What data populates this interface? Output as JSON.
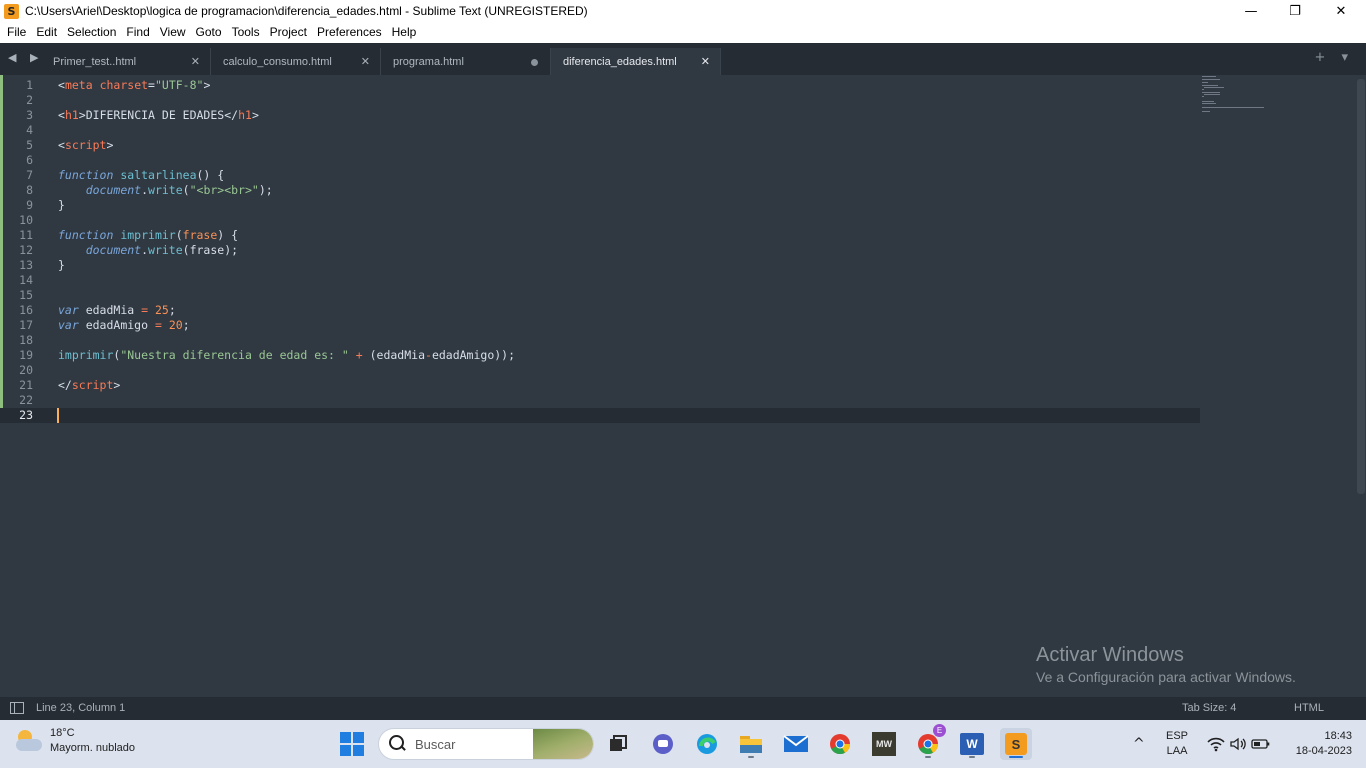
{
  "window": {
    "title": "C:\\Users\\Ariel\\Desktop\\logica de programacion\\diferencia_edades.html - Sublime Text (UNREGISTERED)",
    "app_logo_letter": "S",
    "controls": {
      "minimize": "—",
      "restore": "❐",
      "close": "✕"
    }
  },
  "menu": [
    "File",
    "Edit",
    "Selection",
    "Find",
    "View",
    "Goto",
    "Tools",
    "Project",
    "Preferences",
    "Help"
  ],
  "tabs": [
    {
      "label": "Primer_test..html",
      "state": "close"
    },
    {
      "label": "calculo_consumo.html",
      "state": "close"
    },
    {
      "label": "programa.html",
      "state": "modified"
    },
    {
      "label": "diferencia_edades.html",
      "state": "active"
    }
  ],
  "tab_controls": {
    "nav": "◀ ▶",
    "right": "+ ▾",
    "close_glyph": "✕"
  },
  "editor": {
    "current_line": 23,
    "line_numbers": [
      "1",
      "2",
      "3",
      "4",
      "5",
      "6",
      "7",
      "8",
      "9",
      "10",
      "11",
      "12",
      "13",
      "14",
      "15",
      "16",
      "17",
      "18",
      "19",
      "20",
      "21",
      "22",
      "23"
    ]
  },
  "watermark": {
    "title": "Activar Windows",
    "subtitle": "Ve a Configuración para activar Windows."
  },
  "statusbar": {
    "position": "Line 23, Column 1",
    "tab_size": "Tab Size: 4",
    "syntax": "HTML"
  },
  "taskbar": {
    "weather_temp": "18°C",
    "weather_desc": "Mayorm. nublado",
    "search_placeholder": "Buscar",
    "apps": [
      "task-view",
      "teams-chat",
      "edge",
      "file-explorer",
      "mail",
      "chrome",
      "minecraft",
      "chrome-profile",
      "word",
      "sublime-text"
    ],
    "profile_badge": "E",
    "word_letter": "W",
    "mw_label": "MW",
    "tray_chevron": "^",
    "lang_top": "ESP",
    "lang_bottom": "LAA",
    "time": "18:43",
    "date": "18-04-2023"
  },
  "colors": {
    "editor_bg": "#303841",
    "tab_bar_bg": "#262c33",
    "keyword": "#7aa6da",
    "string": "#99c794",
    "number": "#f99157",
    "tag": "#f97b58",
    "caret": "#f9ae58"
  }
}
